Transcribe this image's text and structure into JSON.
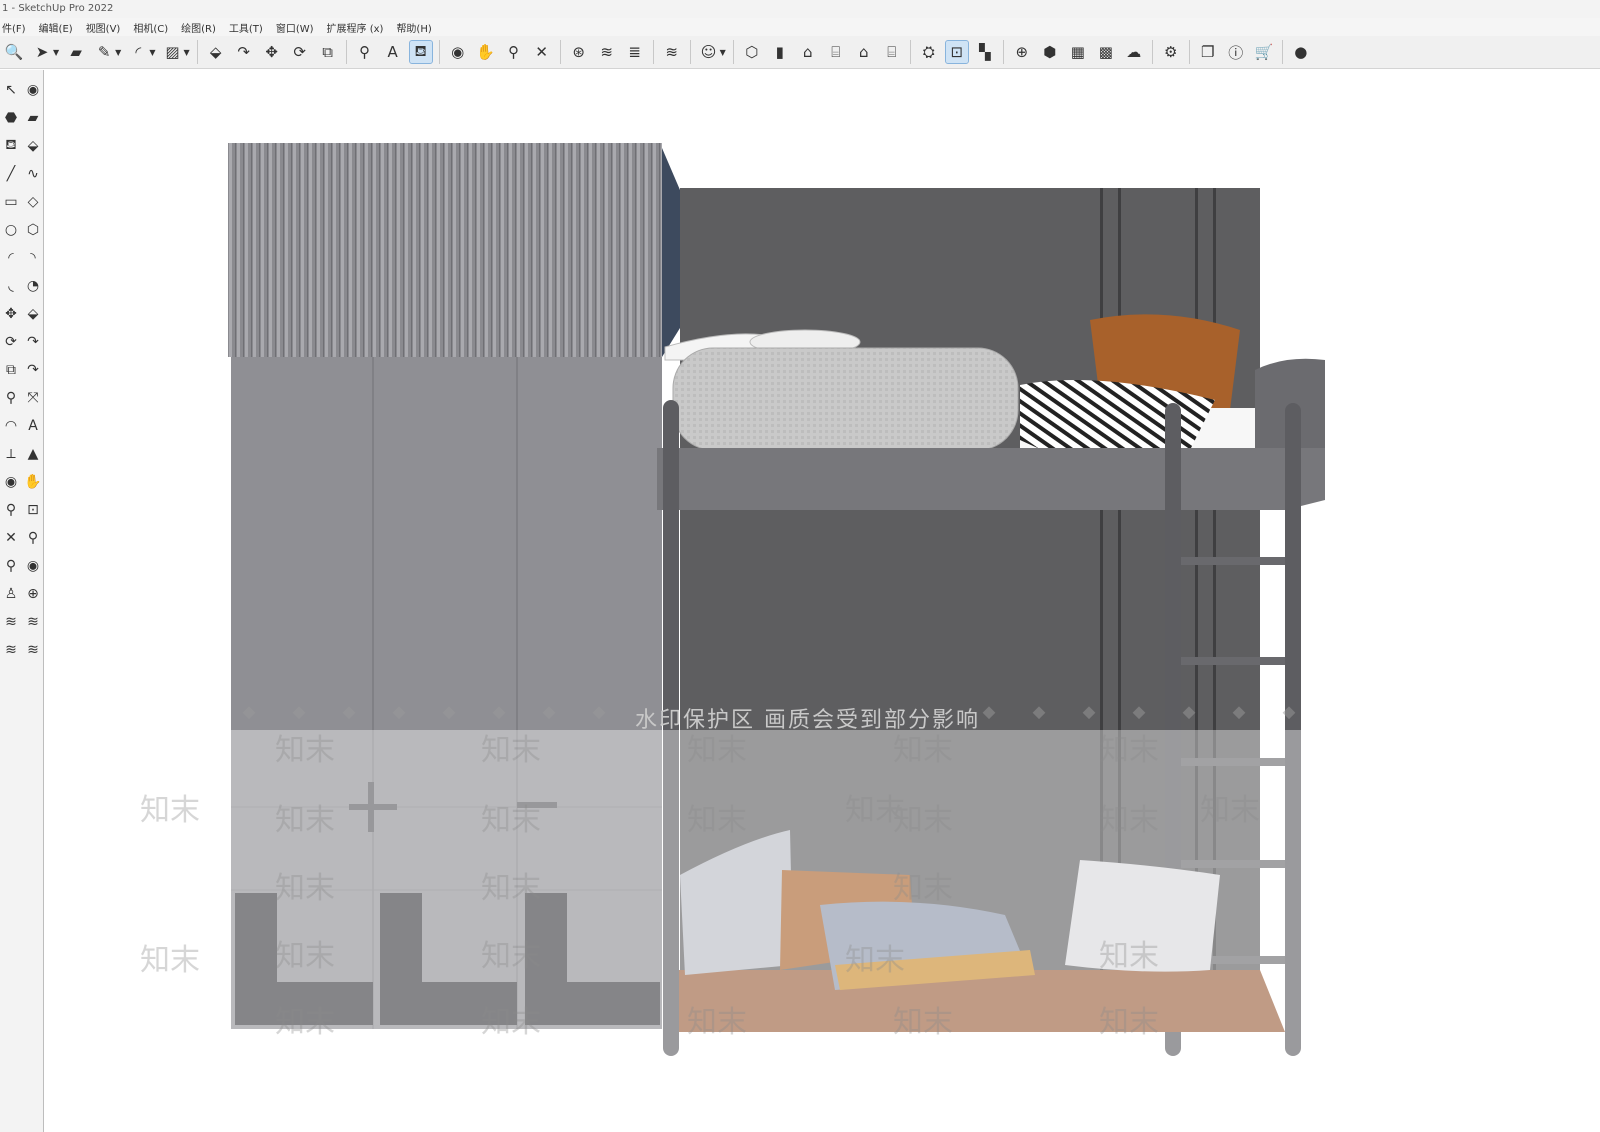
{
  "window": {
    "title": "1 - SketchUp Pro 2022"
  },
  "menu": [
    "件(F)",
    "编辑(E)",
    "视图(V)",
    "相机(C)",
    "绘图(R)",
    "工具(T)",
    "窗口(W)",
    "扩展程序 (x)",
    "帮助(H)"
  ],
  "toolbar_icons": [
    {
      "icon": "zoom-icon",
      "glyph": "🔍"
    },
    {
      "icon": "select-arrow-icon",
      "glyph": "➤",
      "dropdown": true
    },
    {
      "icon": "eraser-icon",
      "glyph": "▰"
    },
    {
      "icon": "pencil-line-icon",
      "glyph": "✎",
      "dropdown": true
    },
    {
      "icon": "arc-icon",
      "glyph": "◜",
      "dropdown": true
    },
    {
      "icon": "rectangle-icon",
      "glyph": "▨",
      "dropdown": true
    },
    {
      "sep": true
    },
    {
      "icon": "push-pull-icon",
      "glyph": "⬙"
    },
    {
      "icon": "follow-me-icon",
      "glyph": "↷"
    },
    {
      "icon": "move-icon",
      "glyph": "✥"
    },
    {
      "icon": "rotate-icon",
      "glyph": "⟳"
    },
    {
      "icon": "scale-icon",
      "glyph": "⧉"
    },
    {
      "sep": true
    },
    {
      "icon": "tape-measure-icon",
      "glyph": "⚲"
    },
    {
      "icon": "text-icon",
      "glyph": "A"
    },
    {
      "icon": "paint-bucket-icon",
      "glyph": "⛾",
      "selected": true
    },
    {
      "sep": true
    },
    {
      "icon": "orbit-icon",
      "glyph": "◉"
    },
    {
      "icon": "pan-icon",
      "glyph": "✋"
    },
    {
      "icon": "zoom-tool-icon",
      "glyph": "⚲"
    },
    {
      "icon": "zoom-extents-icon",
      "glyph": "✕"
    },
    {
      "sep": true
    },
    {
      "icon": "warehouse-icon",
      "glyph": "⊛"
    },
    {
      "icon": "extension-icon",
      "glyph": "≋"
    },
    {
      "icon": "layers-icon",
      "glyph": "≣"
    },
    {
      "sep": true
    },
    {
      "icon": "sandbox-icon",
      "glyph": "≋"
    },
    {
      "sep": true
    },
    {
      "icon": "user-icon",
      "glyph": "☺",
      "dropdown": true
    },
    {
      "sep": true
    },
    {
      "icon": "iso-view-icon",
      "glyph": "⬡"
    },
    {
      "icon": "front-view-icon",
      "glyph": "▮"
    },
    {
      "icon": "home-view-icon",
      "glyph": "⌂"
    },
    {
      "icon": "right-view-icon",
      "glyph": "⌸"
    },
    {
      "icon": "back-view-icon",
      "glyph": "⌂"
    },
    {
      "icon": "left-view-icon",
      "glyph": "⌸"
    },
    {
      "sep": true
    },
    {
      "icon": "solid-tools-icon",
      "glyph": "⛭"
    },
    {
      "icon": "section-plane-icon",
      "glyph": "⊡",
      "selected": true
    },
    {
      "icon": "section-fill-icon",
      "glyph": "▚"
    },
    {
      "sep": true
    },
    {
      "icon": "add-icon",
      "glyph": "⊕"
    },
    {
      "icon": "shield-icon",
      "glyph": "⬢"
    },
    {
      "icon": "building-icon",
      "glyph": "▦"
    },
    {
      "icon": "checker-icon",
      "glyph": "▩"
    },
    {
      "icon": "cloud-upload-icon",
      "glyph": "☁"
    },
    {
      "sep": true
    },
    {
      "icon": "settings-gears-icon",
      "glyph": "⚙"
    },
    {
      "sep": true
    },
    {
      "icon": "window-icon",
      "glyph": "❐"
    },
    {
      "icon": "info-icon",
      "glyph": "ⓘ"
    },
    {
      "icon": "cart-icon",
      "glyph": "🛒"
    },
    {
      "sep": true
    },
    {
      "icon": "account-icon",
      "glyph": "●"
    }
  ],
  "left_tools": [
    {
      "icon": "select-icon",
      "glyph": "↖"
    },
    {
      "icon": "orbit-small-icon",
      "glyph": "◉"
    },
    {
      "icon": "component-icon",
      "glyph": "⬣"
    },
    {
      "icon": "eraser-small-icon",
      "glyph": "▰"
    },
    {
      "icon": "paint-small-icon",
      "glyph": "⛾"
    },
    {
      "icon": "tag-icon",
      "glyph": "⬙"
    },
    {
      "icon": "line-icon",
      "glyph": "╱"
    },
    {
      "icon": "freehand-icon",
      "glyph": "∿"
    },
    {
      "icon": "rect-small-icon",
      "glyph": "▭"
    },
    {
      "icon": "rotated-rect-icon",
      "glyph": "◇"
    },
    {
      "icon": "circle-icon",
      "glyph": "○"
    },
    {
      "icon": "polygon-icon",
      "glyph": "⬡"
    },
    {
      "icon": "arc-small-icon",
      "glyph": "◜"
    },
    {
      "icon": "arc2-icon",
      "glyph": "◝"
    },
    {
      "icon": "arc3-icon",
      "glyph": "◟"
    },
    {
      "icon": "pie-icon",
      "glyph": "◔"
    },
    {
      "icon": "move-small-icon",
      "glyph": "✥"
    },
    {
      "icon": "pushpull-small-icon",
      "glyph": "⬙"
    },
    {
      "icon": "rotate-small-icon",
      "glyph": "⟳"
    },
    {
      "icon": "followme-small-icon",
      "glyph": "↷"
    },
    {
      "icon": "scale-small-icon",
      "glyph": "⧉"
    },
    {
      "icon": "offset-icon",
      "glyph": "↷"
    },
    {
      "icon": "tape-small-icon",
      "glyph": "⚲"
    },
    {
      "icon": "dimension-icon",
      "glyph": "⤧"
    },
    {
      "icon": "protractor-icon",
      "glyph": "◠"
    },
    {
      "icon": "text-small-icon",
      "glyph": "A"
    },
    {
      "icon": "axes-icon",
      "glyph": "⟂"
    },
    {
      "icon": "3dtext-icon",
      "glyph": "▲"
    },
    {
      "icon": "orbit2-icon",
      "glyph": "◉"
    },
    {
      "icon": "pan-small-icon",
      "glyph": "✋"
    },
    {
      "icon": "zoom-small-icon",
      "glyph": "⚲"
    },
    {
      "icon": "zoom-window-icon",
      "glyph": "⊡"
    },
    {
      "icon": "zoom-ext-small-icon",
      "glyph": "✕"
    },
    {
      "icon": "previous-icon",
      "glyph": "⚲"
    },
    {
      "icon": "position-camera-icon",
      "glyph": "⚲"
    },
    {
      "icon": "look-around-icon",
      "glyph": "◉"
    },
    {
      "icon": "walk-icon",
      "glyph": "♙"
    },
    {
      "icon": "section-small-icon",
      "glyph": "⊕"
    },
    {
      "icon": "sandbox-small-icon",
      "glyph": "≋"
    },
    {
      "icon": "sandbox2-icon",
      "glyph": "≋"
    },
    {
      "icon": "sandbox3-icon",
      "glyph": "≋"
    },
    {
      "icon": "sandbox4-icon",
      "glyph": "≋"
    }
  ],
  "watermark": {
    "banner": "水印保护区  画质会受到部分影响",
    "tile": "知末"
  },
  "colors": {
    "accent": "#88b4dd",
    "wardrobe": "#8e8e93",
    "wall": "#5c5c5e",
    "floor_mat": "#9a5e3a"
  }
}
